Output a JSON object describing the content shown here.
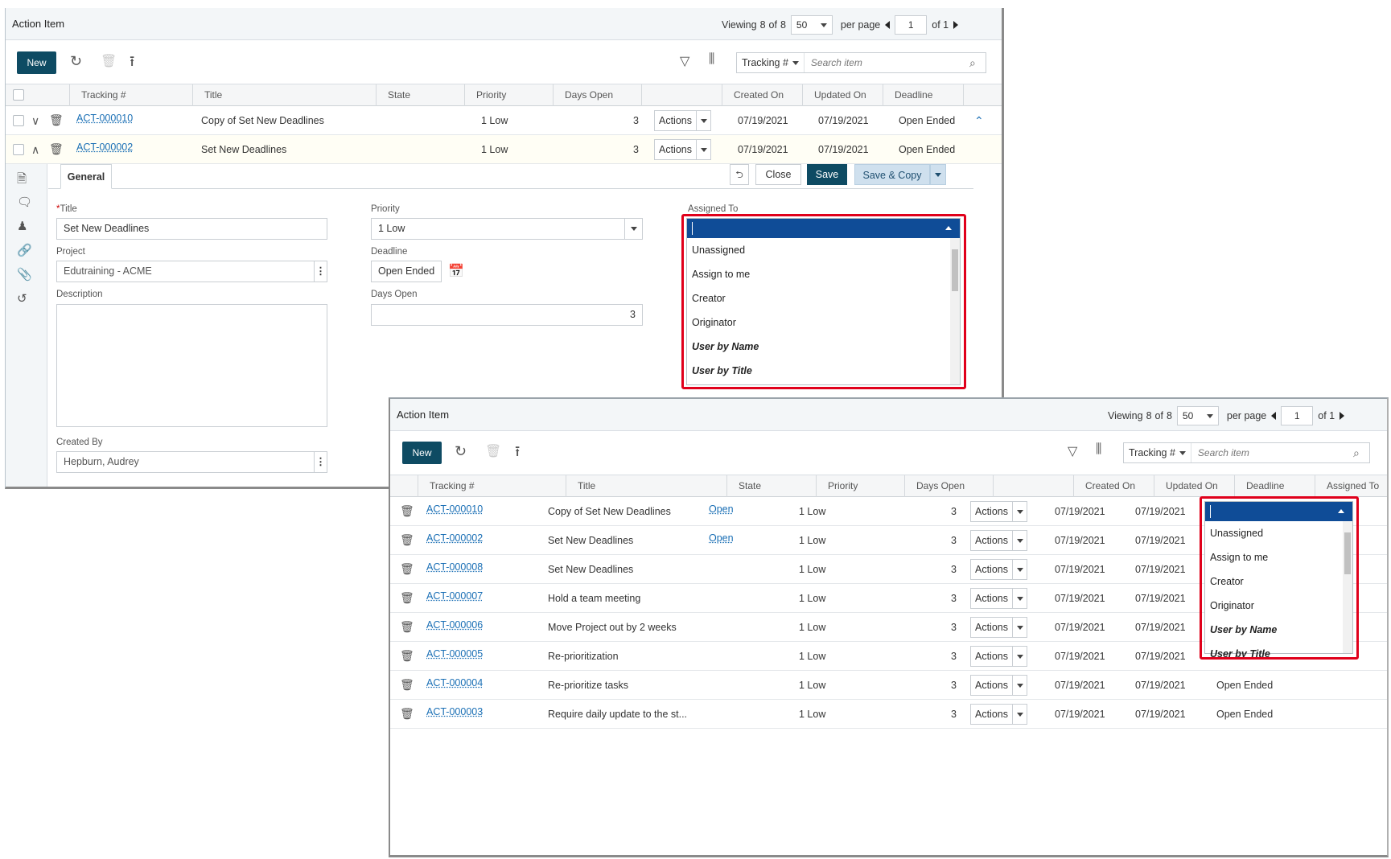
{
  "window1": {
    "title": "Action Item",
    "pager": {
      "viewing_label": "Viewing",
      "viewing_count": "8",
      "viewing_of": "of",
      "viewing_total": "8",
      "per_page_value": "50",
      "per_page_label": "per page",
      "page": "1",
      "of_pages": "of 1"
    },
    "toolbar": {
      "new_label": "New",
      "search_field": "Tracking #",
      "search_placeholder": "Search item"
    },
    "columns": [
      "Tracking #",
      "Title",
      "State",
      "Priority",
      "Days Open",
      "",
      "Created On",
      "Updated On",
      "Deadline"
    ],
    "rows": [
      {
        "tracking": "ACT-000010",
        "title": "Copy of Set New Deadlines",
        "priority": "1 Low",
        "days": "3",
        "actions": "Actions",
        "created": "07/19/2021",
        "updated": "07/19/2021",
        "deadline": "Open Ended"
      },
      {
        "tracking": "ACT-000002",
        "title": "Set New Deadlines",
        "priority": "1 Low",
        "days": "3",
        "actions": "Actions",
        "created": "07/19/2021",
        "updated": "07/19/2021",
        "deadline": "Open Ended"
      }
    ],
    "detail": {
      "tab": "General",
      "close_label": "Close",
      "save_label": "Save",
      "save_copy_label": "Save & Copy",
      "title_label": "Title",
      "title_value": "Set New Deadlines",
      "project_label": "Project",
      "project_value": "Edutraining - ACME",
      "description_label": "Description",
      "created_by_label": "Created By",
      "created_by_value": "Hepburn, Audrey",
      "priority_label": "Priority",
      "priority_value": "1 Low",
      "deadline_label": "Deadline",
      "deadline_value": "Open Ended",
      "days_open_label": "Days Open",
      "days_open_value": "3",
      "assigned_to_label": "Assigned To"
    },
    "assigned_options": [
      "Unassigned",
      "Assign to me",
      "Creator",
      "Originator",
      "User by Name",
      "User by Title"
    ]
  },
  "window2": {
    "title": "Action Item",
    "pager": {
      "viewing_label": "Viewing",
      "viewing_count": "8",
      "viewing_of": "of",
      "viewing_total": "8",
      "per_page_value": "50",
      "per_page_label": "per page",
      "page": "1",
      "of_pages": "of 1"
    },
    "toolbar": {
      "new_label": "New",
      "search_field": "Tracking #",
      "search_placeholder": "Search item"
    },
    "columns": [
      "Tracking #",
      "Title",
      "State",
      "Priority",
      "Days Open",
      "",
      "Created On",
      "Updated On",
      "Deadline",
      "Assigned To"
    ],
    "rows": [
      {
        "tracking": "ACT-000010",
        "title": "Copy of Set New Deadlines",
        "state": "Open",
        "priority": "1 Low",
        "days": "3",
        "actions": "Actions",
        "created": "07/19/2021",
        "updated": "07/19/2021",
        "deadline": ""
      },
      {
        "tracking": "ACT-000002",
        "title": "Set New Deadlines",
        "state": "Open",
        "priority": "1 Low",
        "days": "3",
        "actions": "Actions",
        "created": "07/19/2021",
        "updated": "07/19/2021",
        "deadline": ""
      },
      {
        "tracking": "ACT-000008",
        "title": "Set New Deadlines",
        "state": "",
        "priority": "1 Low",
        "days": "3",
        "actions": "Actions",
        "created": "07/19/2021",
        "updated": "07/19/2021",
        "deadline": ""
      },
      {
        "tracking": "ACT-000007",
        "title": "Hold a team meeting",
        "state": "",
        "priority": "1 Low",
        "days": "3",
        "actions": "Actions",
        "created": "07/19/2021",
        "updated": "07/19/2021",
        "deadline": ""
      },
      {
        "tracking": "ACT-000006",
        "title": "Move Project out by 2 weeks",
        "state": "",
        "priority": "1 Low",
        "days": "3",
        "actions": "Actions",
        "created": "07/19/2021",
        "updated": "07/19/2021",
        "deadline": ""
      },
      {
        "tracking": "ACT-000005",
        "title": "Re-prioritization",
        "state": "",
        "priority": "1 Low",
        "days": "3",
        "actions": "Actions",
        "created": "07/19/2021",
        "updated": "07/19/2021",
        "deadline": ""
      },
      {
        "tracking": "ACT-000004",
        "title": "Re-prioritize tasks",
        "state": "",
        "priority": "1 Low",
        "days": "3",
        "actions": "Actions",
        "created": "07/19/2021",
        "updated": "07/19/2021",
        "deadline": "Open Ended"
      },
      {
        "tracking": "ACT-000003",
        "title": "Require daily update to the st...",
        "state": "",
        "priority": "1 Low",
        "days": "3",
        "actions": "Actions",
        "created": "07/19/2021",
        "updated": "07/19/2021",
        "deadline": "Open Ended"
      }
    ],
    "assigned_options": [
      "Unassigned",
      "Assign to me",
      "Creator",
      "Originator",
      "User by Name",
      "User by Title"
    ]
  },
  "colors": {
    "primary_button": "#0e4b63",
    "dropdown_header": "#0f4c97",
    "highlight_border": "#e0001b",
    "link": "#1a6fb5"
  }
}
